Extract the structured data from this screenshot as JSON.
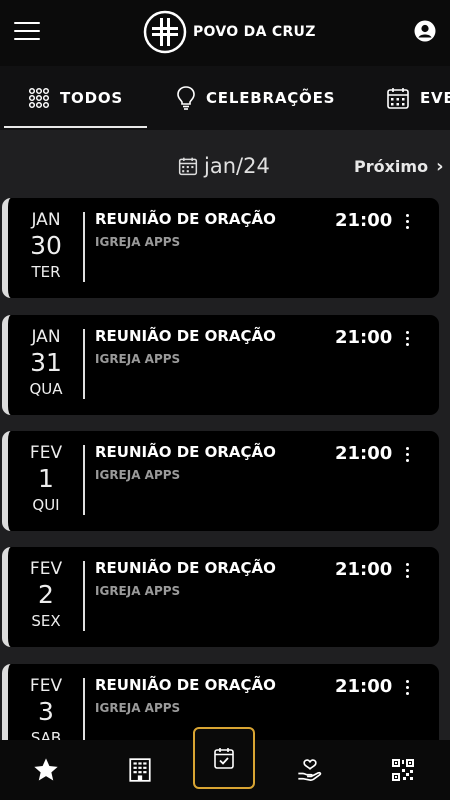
{
  "header": {
    "app_name": "POVO DA CRUZ"
  },
  "tabs": [
    {
      "label": "TODOS",
      "icon": "grid-dots-icon",
      "active": true
    },
    {
      "label": "CELEBRAÇÕES",
      "icon": "lightbulb-icon",
      "active": false
    },
    {
      "label": "EVENTOS",
      "icon": "calendar-icon",
      "active": false
    }
  ],
  "month_nav": {
    "current": "jan/24",
    "next_label": "Próximo",
    "next_chevron": "›"
  },
  "events": [
    {
      "month": "JAN",
      "day": "30",
      "weekday": "TER",
      "title": "REUNIÃO DE ORAÇÃO",
      "church": "IGREJA APPS",
      "time": "21:00"
    },
    {
      "month": "JAN",
      "day": "31",
      "weekday": "QUA",
      "title": "REUNIÃO DE ORAÇÃO",
      "church": "IGREJA APPS",
      "time": "21:00"
    },
    {
      "month": "FEV",
      "day": "1",
      "weekday": "QUI",
      "title": "REUNIÃO DE ORAÇÃO",
      "church": "IGREJA APPS",
      "time": "21:00"
    },
    {
      "month": "FEV",
      "day": "2",
      "weekday": "SEX",
      "title": "REUNIÃO DE ORAÇÃO",
      "church": "IGREJA APPS",
      "time": "21:00"
    },
    {
      "month": "FEV",
      "day": "3",
      "weekday": "SAB",
      "title": "REUNIÃO DE ORAÇÃO",
      "church": "IGREJA APPS",
      "time": "21:00"
    }
  ],
  "bottom_nav": [
    {
      "name": "favorites",
      "icon": "star-icon"
    },
    {
      "name": "church",
      "icon": "building-icon"
    },
    {
      "name": "agenda",
      "icon": "calendar-check-icon",
      "active": true
    },
    {
      "name": "donate",
      "icon": "heart-hand-icon"
    },
    {
      "name": "qr",
      "icon": "qr-code-icon"
    }
  ],
  "colors": {
    "background": "#1f1f21",
    "card": "#000000",
    "accent_active": "#d9a533",
    "card_border": "#dcdcdc"
  }
}
